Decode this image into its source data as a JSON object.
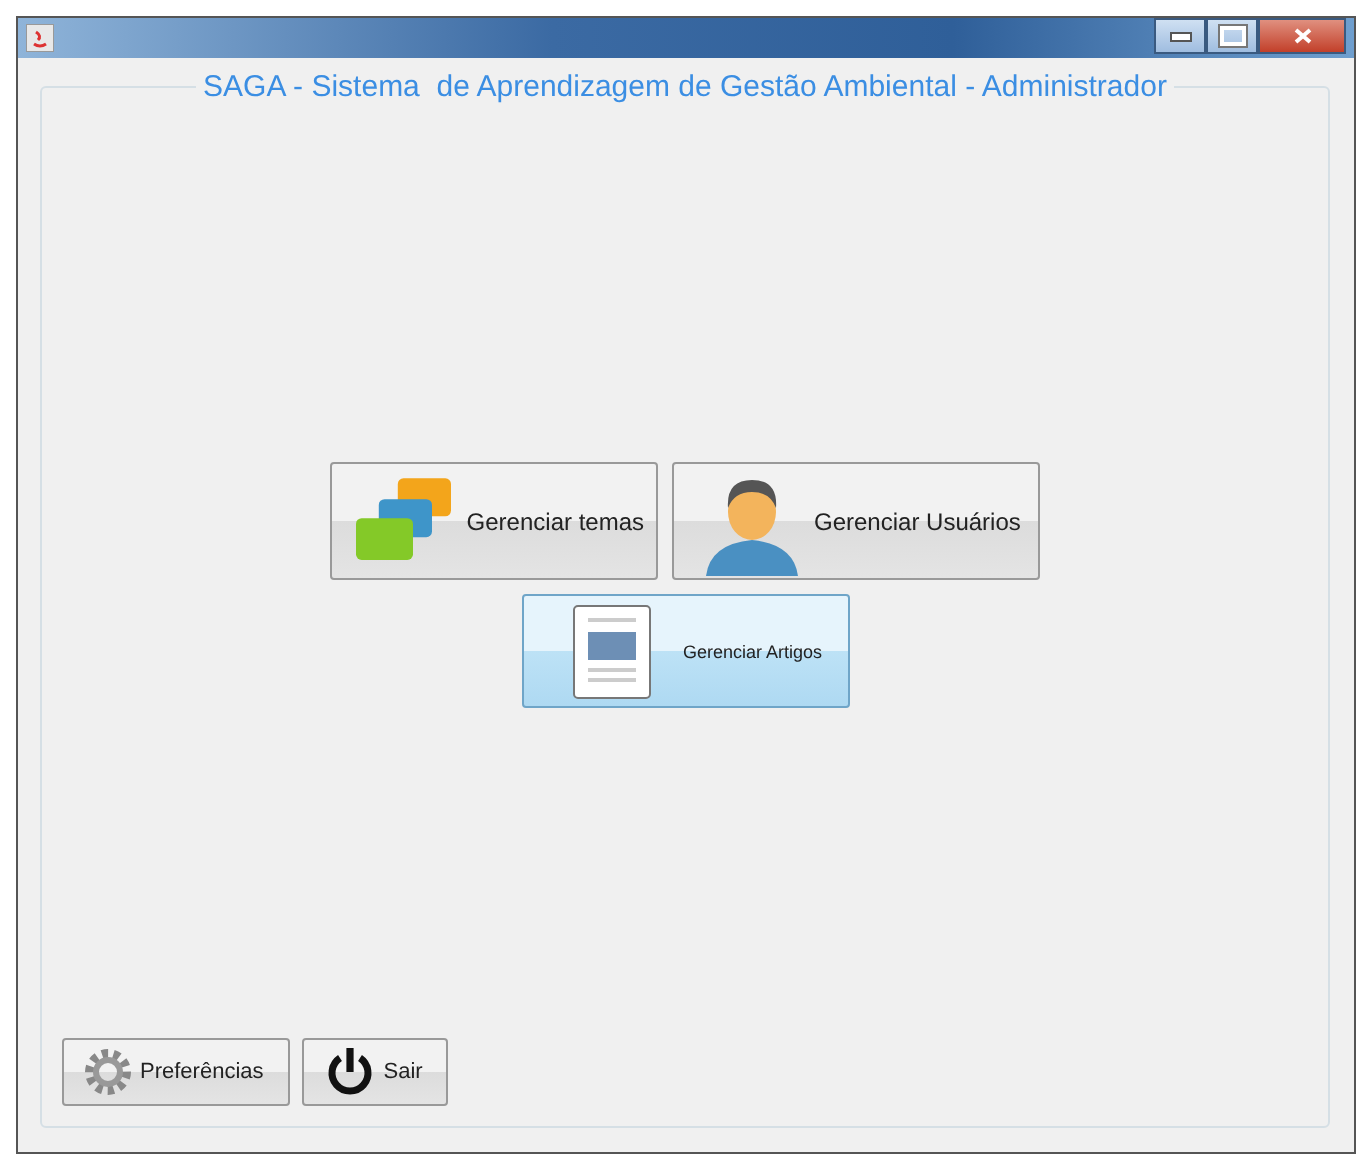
{
  "window": {
    "controls": [
      {
        "kind": "minimize"
      },
      {
        "kind": "maximize"
      },
      {
        "kind": "close"
      }
    ]
  },
  "panel": {
    "title": "SAGA - Sistema  de Aprendizagem de Gestão Ambiental - Administrador"
  },
  "main_buttons": [
    {
      "label": "Gerenciar temas",
      "kind": "cards",
      "highlighted": false
    },
    {
      "label": "Gerenciar Usuários",
      "kind": "user",
      "highlighted": false
    },
    {
      "label": "Gerenciar Artigos",
      "kind": "document",
      "highlighted": true
    }
  ],
  "bottom_buttons": [
    {
      "label": "Preferências",
      "kind": "gear"
    },
    {
      "label": "Sair",
      "kind": "power"
    }
  ]
}
